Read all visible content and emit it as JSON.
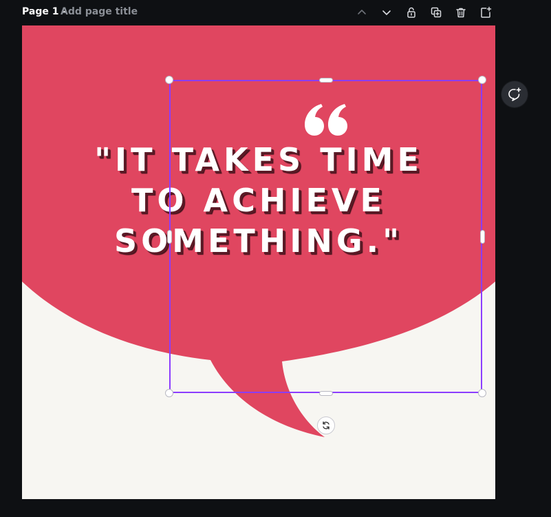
{
  "header": {
    "page_label": "Page 1 -",
    "page_title_placeholder": "Add page title"
  },
  "toolbar": {
    "icons": [
      "chevron-up-icon",
      "chevron-down-icon",
      "lock-icon",
      "duplicate-page-icon",
      "delete-icon",
      "add-page-icon"
    ]
  },
  "design": {
    "quote_lines": [
      "\"IT TAKES TIME",
      "TO ACHIEVE",
      "SOMETHING.\""
    ],
    "colors": {
      "bubble": "#e04660",
      "background": "#f7f6f2",
      "text": "#ffffff",
      "text_shadow": "#5b1a26",
      "selection": "#8b3dff",
      "app_background": "#0e1013"
    }
  },
  "side_actions": {
    "comment_icon": "add-comment-icon"
  }
}
